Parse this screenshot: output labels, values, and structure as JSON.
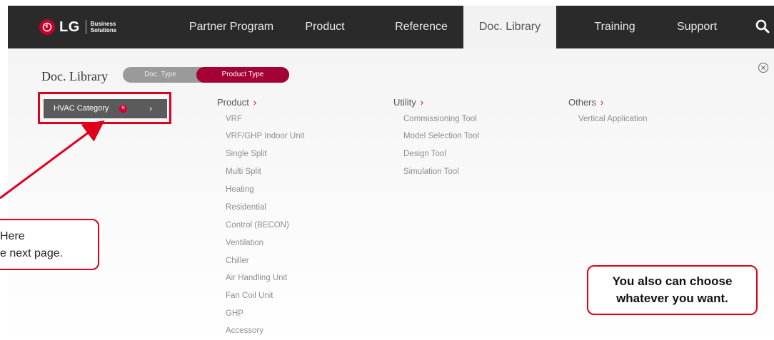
{
  "nav": {
    "logo_text": "LG",
    "logo_sub_line1": "Business",
    "logo_sub_line2": "Solutions",
    "items": [
      {
        "label": "Partner Program"
      },
      {
        "label": "Product"
      },
      {
        "label": "Reference"
      },
      {
        "label": "Doc. Library"
      },
      {
        "label": "Training"
      },
      {
        "label": "Support"
      }
    ],
    "active_item": "Doc. Library",
    "search_icon": "search-icon"
  },
  "panel": {
    "title": "Doc. Library",
    "toggle": {
      "left": "Doc. Type",
      "right": "Product Type",
      "selected": "Product Type"
    },
    "close_icon": "close-icon",
    "category": {
      "label": "HVAC Category",
      "badge": "N",
      "chevron": "›"
    }
  },
  "columns": {
    "product": {
      "heading": "Product",
      "arrow": "›",
      "items": [
        "VRF",
        "VRF/GHP Indoor Unit",
        "Single Split",
        "Multi Split",
        "Heating",
        "Residential",
        "Control (BECON)",
        "Ventilation",
        "Chiller",
        "Air Handling Unit",
        "Fan Coil Unit",
        "GHP",
        "Accessory"
      ]
    },
    "utility": {
      "heading": "Utility",
      "arrow": "›",
      "items": [
        "Commissioning Tool",
        "Model Selection Tool",
        "Design Tool",
        "Simulation Tool"
      ]
    },
    "others": {
      "heading": "Others",
      "arrow": "›",
      "items": [
        "Vertical Application"
      ]
    }
  },
  "callouts": {
    "left": {
      "line1": "Here",
      "line2": "e next page."
    },
    "right": {
      "line1": "You also can choose",
      "line2": "whatever you want."
    }
  },
  "colors": {
    "accent": "#a50034",
    "callout_border": "#e0001a",
    "nav_bg": "#2a2a2a"
  }
}
